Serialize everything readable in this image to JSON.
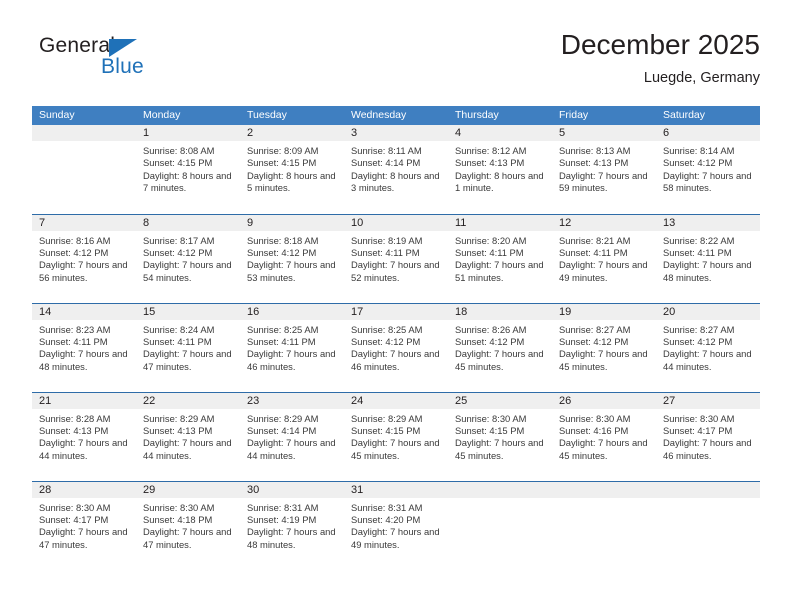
{
  "brand": {
    "name_dark": "General",
    "name_blue": "Blue",
    "triangle_color": "#1f71b8"
  },
  "header": {
    "title": "December 2025",
    "subtitle": "Luegde, Germany"
  },
  "colors": {
    "header_row_bg": "#3f7fc1",
    "header_row_text": "#ffffff",
    "day_number_band": "#efefef",
    "week_separator": "#2e6ca8",
    "body_text": "#3a3a3a"
  },
  "weekdays": [
    "Sunday",
    "Monday",
    "Tuesday",
    "Wednesday",
    "Thursday",
    "Friday",
    "Saturday"
  ],
  "weeks": [
    [
      {
        "day": "",
        "sunrise": "",
        "sunset": "",
        "daylight": "",
        "empty": true
      },
      {
        "day": "1",
        "sunrise": "Sunrise: 8:08 AM",
        "sunset": "Sunset: 4:15 PM",
        "daylight": "Daylight: 8 hours and 7 minutes."
      },
      {
        "day": "2",
        "sunrise": "Sunrise: 8:09 AM",
        "sunset": "Sunset: 4:15 PM",
        "daylight": "Daylight: 8 hours and 5 minutes."
      },
      {
        "day": "3",
        "sunrise": "Sunrise: 8:11 AM",
        "sunset": "Sunset: 4:14 PM",
        "daylight": "Daylight: 8 hours and 3 minutes."
      },
      {
        "day": "4",
        "sunrise": "Sunrise: 8:12 AM",
        "sunset": "Sunset: 4:13 PM",
        "daylight": "Daylight: 8 hours and 1 minute."
      },
      {
        "day": "5",
        "sunrise": "Sunrise: 8:13 AM",
        "sunset": "Sunset: 4:13 PM",
        "daylight": "Daylight: 7 hours and 59 minutes."
      },
      {
        "day": "6",
        "sunrise": "Sunrise: 8:14 AM",
        "sunset": "Sunset: 4:12 PM",
        "daylight": "Daylight: 7 hours and 58 minutes."
      }
    ],
    [
      {
        "day": "7",
        "sunrise": "Sunrise: 8:16 AM",
        "sunset": "Sunset: 4:12 PM",
        "daylight": "Daylight: 7 hours and 56 minutes."
      },
      {
        "day": "8",
        "sunrise": "Sunrise: 8:17 AM",
        "sunset": "Sunset: 4:12 PM",
        "daylight": "Daylight: 7 hours and 54 minutes."
      },
      {
        "day": "9",
        "sunrise": "Sunrise: 8:18 AM",
        "sunset": "Sunset: 4:12 PM",
        "daylight": "Daylight: 7 hours and 53 minutes."
      },
      {
        "day": "10",
        "sunrise": "Sunrise: 8:19 AM",
        "sunset": "Sunset: 4:11 PM",
        "daylight": "Daylight: 7 hours and 52 minutes."
      },
      {
        "day": "11",
        "sunrise": "Sunrise: 8:20 AM",
        "sunset": "Sunset: 4:11 PM",
        "daylight": "Daylight: 7 hours and 51 minutes."
      },
      {
        "day": "12",
        "sunrise": "Sunrise: 8:21 AM",
        "sunset": "Sunset: 4:11 PM",
        "daylight": "Daylight: 7 hours and 49 minutes."
      },
      {
        "day": "13",
        "sunrise": "Sunrise: 8:22 AM",
        "sunset": "Sunset: 4:11 PM",
        "daylight": "Daylight: 7 hours and 48 minutes."
      }
    ],
    [
      {
        "day": "14",
        "sunrise": "Sunrise: 8:23 AM",
        "sunset": "Sunset: 4:11 PM",
        "daylight": "Daylight: 7 hours and 48 minutes."
      },
      {
        "day": "15",
        "sunrise": "Sunrise: 8:24 AM",
        "sunset": "Sunset: 4:11 PM",
        "daylight": "Daylight: 7 hours and 47 minutes."
      },
      {
        "day": "16",
        "sunrise": "Sunrise: 8:25 AM",
        "sunset": "Sunset: 4:11 PM",
        "daylight": "Daylight: 7 hours and 46 minutes."
      },
      {
        "day": "17",
        "sunrise": "Sunrise: 8:25 AM",
        "sunset": "Sunset: 4:12 PM",
        "daylight": "Daylight: 7 hours and 46 minutes."
      },
      {
        "day": "18",
        "sunrise": "Sunrise: 8:26 AM",
        "sunset": "Sunset: 4:12 PM",
        "daylight": "Daylight: 7 hours and 45 minutes."
      },
      {
        "day": "19",
        "sunrise": "Sunrise: 8:27 AM",
        "sunset": "Sunset: 4:12 PM",
        "daylight": "Daylight: 7 hours and 45 minutes."
      },
      {
        "day": "20",
        "sunrise": "Sunrise: 8:27 AM",
        "sunset": "Sunset: 4:12 PM",
        "daylight": "Daylight: 7 hours and 44 minutes."
      }
    ],
    [
      {
        "day": "21",
        "sunrise": "Sunrise: 8:28 AM",
        "sunset": "Sunset: 4:13 PM",
        "daylight": "Daylight: 7 hours and 44 minutes."
      },
      {
        "day": "22",
        "sunrise": "Sunrise: 8:29 AM",
        "sunset": "Sunset: 4:13 PM",
        "daylight": "Daylight: 7 hours and 44 minutes."
      },
      {
        "day": "23",
        "sunrise": "Sunrise: 8:29 AM",
        "sunset": "Sunset: 4:14 PM",
        "daylight": "Daylight: 7 hours and 44 minutes."
      },
      {
        "day": "24",
        "sunrise": "Sunrise: 8:29 AM",
        "sunset": "Sunset: 4:15 PM",
        "daylight": "Daylight: 7 hours and 45 minutes."
      },
      {
        "day": "25",
        "sunrise": "Sunrise: 8:30 AM",
        "sunset": "Sunset: 4:15 PM",
        "daylight": "Daylight: 7 hours and 45 minutes."
      },
      {
        "day": "26",
        "sunrise": "Sunrise: 8:30 AM",
        "sunset": "Sunset: 4:16 PM",
        "daylight": "Daylight: 7 hours and 45 minutes."
      },
      {
        "day": "27",
        "sunrise": "Sunrise: 8:30 AM",
        "sunset": "Sunset: 4:17 PM",
        "daylight": "Daylight: 7 hours and 46 minutes."
      }
    ],
    [
      {
        "day": "28",
        "sunrise": "Sunrise: 8:30 AM",
        "sunset": "Sunset: 4:17 PM",
        "daylight": "Daylight: 7 hours and 47 minutes."
      },
      {
        "day": "29",
        "sunrise": "Sunrise: 8:30 AM",
        "sunset": "Sunset: 4:18 PM",
        "daylight": "Daylight: 7 hours and 47 minutes."
      },
      {
        "day": "30",
        "sunrise": "Sunrise: 8:31 AM",
        "sunset": "Sunset: 4:19 PM",
        "daylight": "Daylight: 7 hours and 48 minutes."
      },
      {
        "day": "31",
        "sunrise": "Sunrise: 8:31 AM",
        "sunset": "Sunset: 4:20 PM",
        "daylight": "Daylight: 7 hours and 49 minutes."
      },
      {
        "day": "",
        "sunrise": "",
        "sunset": "",
        "daylight": "",
        "empty": true
      },
      {
        "day": "",
        "sunrise": "",
        "sunset": "",
        "daylight": "",
        "empty": true
      },
      {
        "day": "",
        "sunrise": "",
        "sunset": "",
        "daylight": "",
        "empty": true
      }
    ]
  ]
}
